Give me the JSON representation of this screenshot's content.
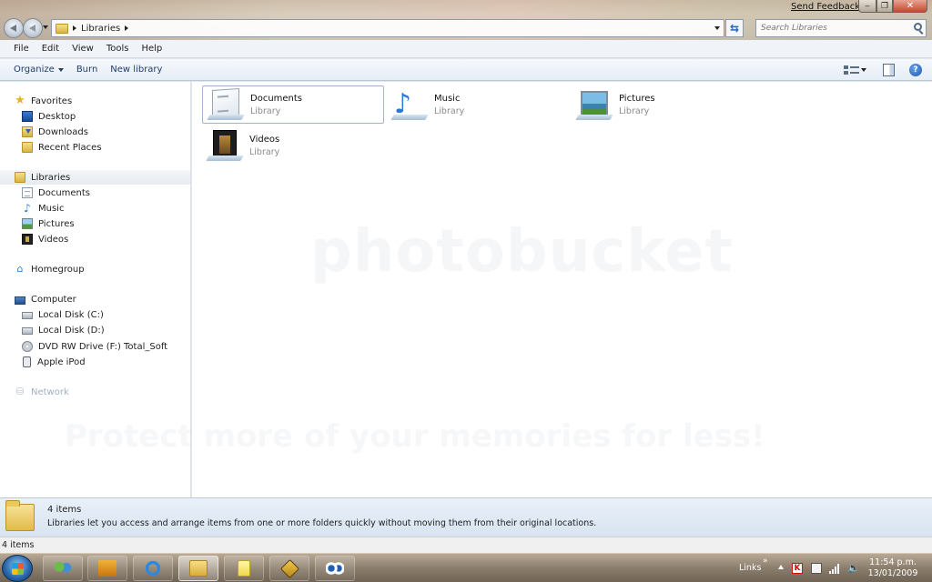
{
  "window": {
    "send_feedback": "Send Feedback",
    "minimize_glyph": "‒",
    "maximize_glyph": "❐",
    "close_glyph": "✕"
  },
  "address": {
    "path": [
      "Libraries"
    ],
    "search_placeholder": "Search Libraries"
  },
  "menu": [
    "File",
    "Edit",
    "View",
    "Tools",
    "Help"
  ],
  "commands": {
    "organize": "Organize",
    "burn": "Burn",
    "new_library": "New library"
  },
  "nav": {
    "favorites": {
      "label": "Favorites",
      "items": [
        "Desktop",
        "Downloads",
        "Recent Places"
      ]
    },
    "libraries": {
      "label": "Libraries",
      "items": [
        "Documents",
        "Music",
        "Pictures",
        "Videos"
      ]
    },
    "homegroup": "Homegroup",
    "computer": {
      "label": "Computer",
      "items": [
        "Local Disk (C:)",
        "Local Disk (D:)",
        "DVD RW Drive (F:) Total_Soft",
        "Apple iPod"
      ]
    },
    "network": "Network"
  },
  "content": {
    "libraries": [
      {
        "name": "Documents",
        "type": "Library",
        "icon": "documents-library-icon",
        "selected": true
      },
      {
        "name": "Music",
        "type": "Library",
        "icon": "music-library-icon",
        "selected": false
      },
      {
        "name": "Pictures",
        "type": "Library",
        "icon": "pictures-library-icon",
        "selected": false
      },
      {
        "name": "Videos",
        "type": "Library",
        "icon": "videos-library-icon",
        "selected": false
      }
    ],
    "watermark_line1": "photobucket",
    "watermark_line2": "Protect more of your memories for less!"
  },
  "details": {
    "count": "4 items",
    "description": "Libraries let you access and arrange items from one or more folders quickly without moving them from their original locations."
  },
  "status": {
    "count": "4 items"
  },
  "taskbar": {
    "links_label": "Links",
    "links_chevron": "»",
    "time": "11:54 p.m.",
    "date": "13/01/2009",
    "tray_av_glyph": "K",
    "volume_glyph": "🔈"
  },
  "colors": {
    "accent": "#2a66b6",
    "selection_border": "#9db5d3",
    "details_bg": "#d8e4f1"
  }
}
